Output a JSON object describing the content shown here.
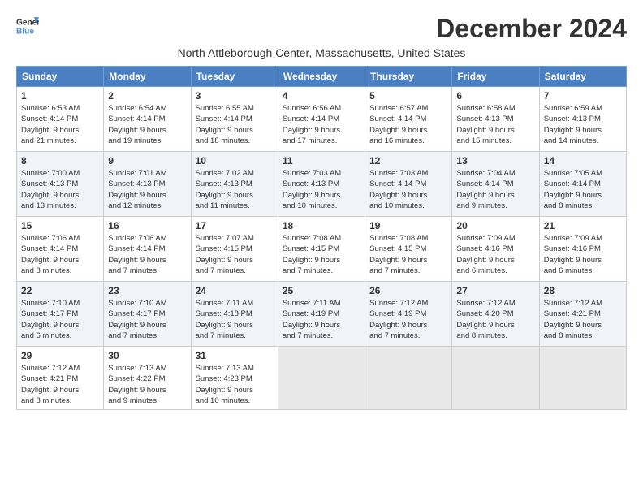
{
  "logo": {
    "line1": "General",
    "line2": "Blue"
  },
  "title": "December 2024",
  "subtitle": "North Attleborough Center, Massachusetts, United States",
  "days_of_week": [
    "Sunday",
    "Monday",
    "Tuesday",
    "Wednesday",
    "Thursday",
    "Friday",
    "Saturday"
  ],
  "weeks": [
    [
      {
        "day": "1",
        "info": "Sunrise: 6:53 AM\nSunset: 4:14 PM\nDaylight: 9 hours\nand 21 minutes."
      },
      {
        "day": "2",
        "info": "Sunrise: 6:54 AM\nSunset: 4:14 PM\nDaylight: 9 hours\nand 19 minutes."
      },
      {
        "day": "3",
        "info": "Sunrise: 6:55 AM\nSunset: 4:14 PM\nDaylight: 9 hours\nand 18 minutes."
      },
      {
        "day": "4",
        "info": "Sunrise: 6:56 AM\nSunset: 4:14 PM\nDaylight: 9 hours\nand 17 minutes."
      },
      {
        "day": "5",
        "info": "Sunrise: 6:57 AM\nSunset: 4:14 PM\nDaylight: 9 hours\nand 16 minutes."
      },
      {
        "day": "6",
        "info": "Sunrise: 6:58 AM\nSunset: 4:13 PM\nDaylight: 9 hours\nand 15 minutes."
      },
      {
        "day": "7",
        "info": "Sunrise: 6:59 AM\nSunset: 4:13 PM\nDaylight: 9 hours\nand 14 minutes."
      }
    ],
    [
      {
        "day": "8",
        "info": "Sunrise: 7:00 AM\nSunset: 4:13 PM\nDaylight: 9 hours\nand 13 minutes."
      },
      {
        "day": "9",
        "info": "Sunrise: 7:01 AM\nSunset: 4:13 PM\nDaylight: 9 hours\nand 12 minutes."
      },
      {
        "day": "10",
        "info": "Sunrise: 7:02 AM\nSunset: 4:13 PM\nDaylight: 9 hours\nand 11 minutes."
      },
      {
        "day": "11",
        "info": "Sunrise: 7:03 AM\nSunset: 4:13 PM\nDaylight: 9 hours\nand 10 minutes."
      },
      {
        "day": "12",
        "info": "Sunrise: 7:03 AM\nSunset: 4:14 PM\nDaylight: 9 hours\nand 10 minutes."
      },
      {
        "day": "13",
        "info": "Sunrise: 7:04 AM\nSunset: 4:14 PM\nDaylight: 9 hours\nand 9 minutes."
      },
      {
        "day": "14",
        "info": "Sunrise: 7:05 AM\nSunset: 4:14 PM\nDaylight: 9 hours\nand 8 minutes."
      }
    ],
    [
      {
        "day": "15",
        "info": "Sunrise: 7:06 AM\nSunset: 4:14 PM\nDaylight: 9 hours\nand 8 minutes."
      },
      {
        "day": "16",
        "info": "Sunrise: 7:06 AM\nSunset: 4:14 PM\nDaylight: 9 hours\nand 7 minutes."
      },
      {
        "day": "17",
        "info": "Sunrise: 7:07 AM\nSunset: 4:15 PM\nDaylight: 9 hours\nand 7 minutes."
      },
      {
        "day": "18",
        "info": "Sunrise: 7:08 AM\nSunset: 4:15 PM\nDaylight: 9 hours\nand 7 minutes."
      },
      {
        "day": "19",
        "info": "Sunrise: 7:08 AM\nSunset: 4:15 PM\nDaylight: 9 hours\nand 7 minutes."
      },
      {
        "day": "20",
        "info": "Sunrise: 7:09 AM\nSunset: 4:16 PM\nDaylight: 9 hours\nand 6 minutes."
      },
      {
        "day": "21",
        "info": "Sunrise: 7:09 AM\nSunset: 4:16 PM\nDaylight: 9 hours\nand 6 minutes."
      }
    ],
    [
      {
        "day": "22",
        "info": "Sunrise: 7:10 AM\nSunset: 4:17 PM\nDaylight: 9 hours\nand 6 minutes."
      },
      {
        "day": "23",
        "info": "Sunrise: 7:10 AM\nSunset: 4:17 PM\nDaylight: 9 hours\nand 7 minutes."
      },
      {
        "day": "24",
        "info": "Sunrise: 7:11 AM\nSunset: 4:18 PM\nDaylight: 9 hours\nand 7 minutes."
      },
      {
        "day": "25",
        "info": "Sunrise: 7:11 AM\nSunset: 4:19 PM\nDaylight: 9 hours\nand 7 minutes."
      },
      {
        "day": "26",
        "info": "Sunrise: 7:12 AM\nSunset: 4:19 PM\nDaylight: 9 hours\nand 7 minutes."
      },
      {
        "day": "27",
        "info": "Sunrise: 7:12 AM\nSunset: 4:20 PM\nDaylight: 9 hours\nand 8 minutes."
      },
      {
        "day": "28",
        "info": "Sunrise: 7:12 AM\nSunset: 4:21 PM\nDaylight: 9 hours\nand 8 minutes."
      }
    ],
    [
      {
        "day": "29",
        "info": "Sunrise: 7:12 AM\nSunset: 4:21 PM\nDaylight: 9 hours\nand 8 minutes."
      },
      {
        "day": "30",
        "info": "Sunrise: 7:13 AM\nSunset: 4:22 PM\nDaylight: 9 hours\nand 9 minutes."
      },
      {
        "day": "31",
        "info": "Sunrise: 7:13 AM\nSunset: 4:23 PM\nDaylight: 9 hours\nand 10 minutes."
      },
      {
        "day": "",
        "info": ""
      },
      {
        "day": "",
        "info": ""
      },
      {
        "day": "",
        "info": ""
      },
      {
        "day": "",
        "info": ""
      }
    ]
  ]
}
